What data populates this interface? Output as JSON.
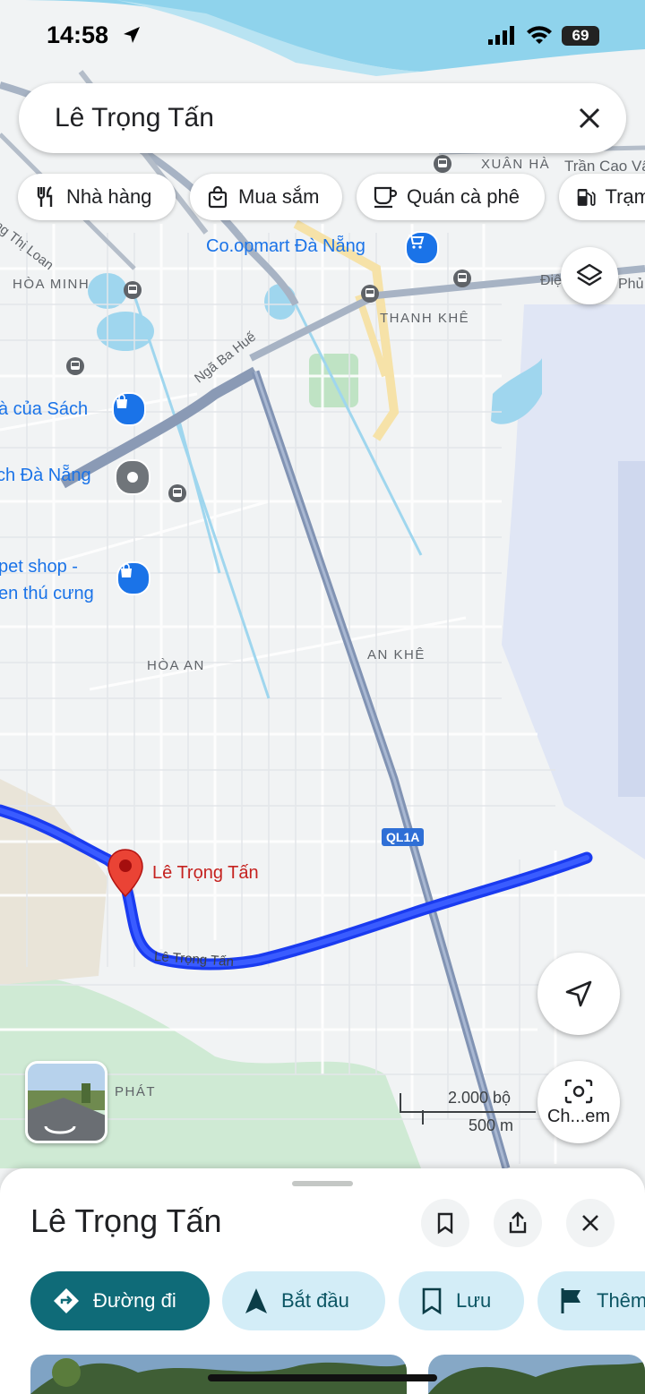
{
  "status_bar": {
    "time": "14:58",
    "battery": "69"
  },
  "search": {
    "query": "Lê Trọng Tấn"
  },
  "categories": [
    {
      "label": "Nhà hàng",
      "icon": "fork-knife-icon"
    },
    {
      "label": "Mua sắm",
      "icon": "shopping-bag-icon"
    },
    {
      "label": "Quán cà phê",
      "icon": "coffee-cup-icon"
    },
    {
      "label": "Trạm",
      "icon": "gas-station-icon"
    }
  ],
  "map": {
    "areas": {
      "xuan_ha": "XUÂN HÀ",
      "hoa_minh": "HÒA MINH",
      "thanh_khe": "THANH KHÊ",
      "hoa_an": "HÒA AN",
      "an_khe": "AN KHÊ",
      "phat": "PHÁT"
    },
    "streets": {
      "tran_cao_van": "Trần Cao Vâ",
      "nga_ba_hue": "Ngã Ba Huế",
      "thi_loan": "ặng Thị Loan",
      "dien_phu": "Điệ",
      "phu": "Phủ",
      "route_street": "Lê Trọng Tấn"
    },
    "pois": {
      "coopmart": "Co.opmart Đà Nẵng",
      "nha_sach": "à của Sách",
      "da_nang": "ch Đà Nẵng",
      "pet_shop_1": "pet shop -",
      "pet_shop_2": "en thú cưng"
    },
    "highway_shield": "QL1A",
    "pin_label": "Lê Trọng Tấn",
    "scale": {
      "imperial": "2.000 bộ",
      "metric": "500 m"
    },
    "camera_label": "Ch...em"
  },
  "sheet": {
    "title": "Lê Trọng Tấn",
    "actions": [
      {
        "label": "Đường đi",
        "icon": "directions-icon"
      },
      {
        "label": "Bắt đầu",
        "icon": "navigation-arrow-icon"
      },
      {
        "label": "Lưu",
        "icon": "bookmark-icon"
      },
      {
        "label": "Thêm",
        "icon": "flag-icon"
      }
    ]
  },
  "colors": {
    "route": "#1a3bf0",
    "accent": "#0f6b78",
    "chip_bg": "#d3edf7",
    "pin": "#ea4335"
  }
}
